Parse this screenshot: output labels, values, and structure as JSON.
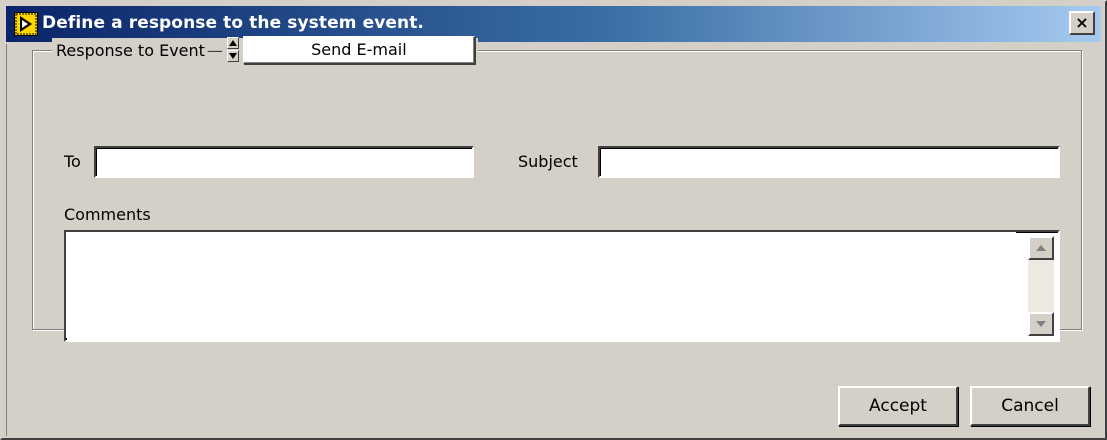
{
  "window": {
    "title": "Define a response to the system event.",
    "close_glyph": "×",
    "app_icon": "labview-run-arrow-icon"
  },
  "response_group": {
    "label": "Response to Event",
    "dash": "—",
    "selected_response": "Send E-mail"
  },
  "fields": {
    "to_label": "To",
    "to_value": "",
    "subject_label": "Subject",
    "subject_value": "",
    "comments_label": "Comments",
    "comments_value": ""
  },
  "buttons": {
    "accept_label": "Accept",
    "cancel_label": "Cancel"
  },
  "colors": {
    "face": "#d4d0c8",
    "title_start": "#0a246a",
    "title_end": "#a6caf0",
    "title_text": "#ffffff"
  }
}
